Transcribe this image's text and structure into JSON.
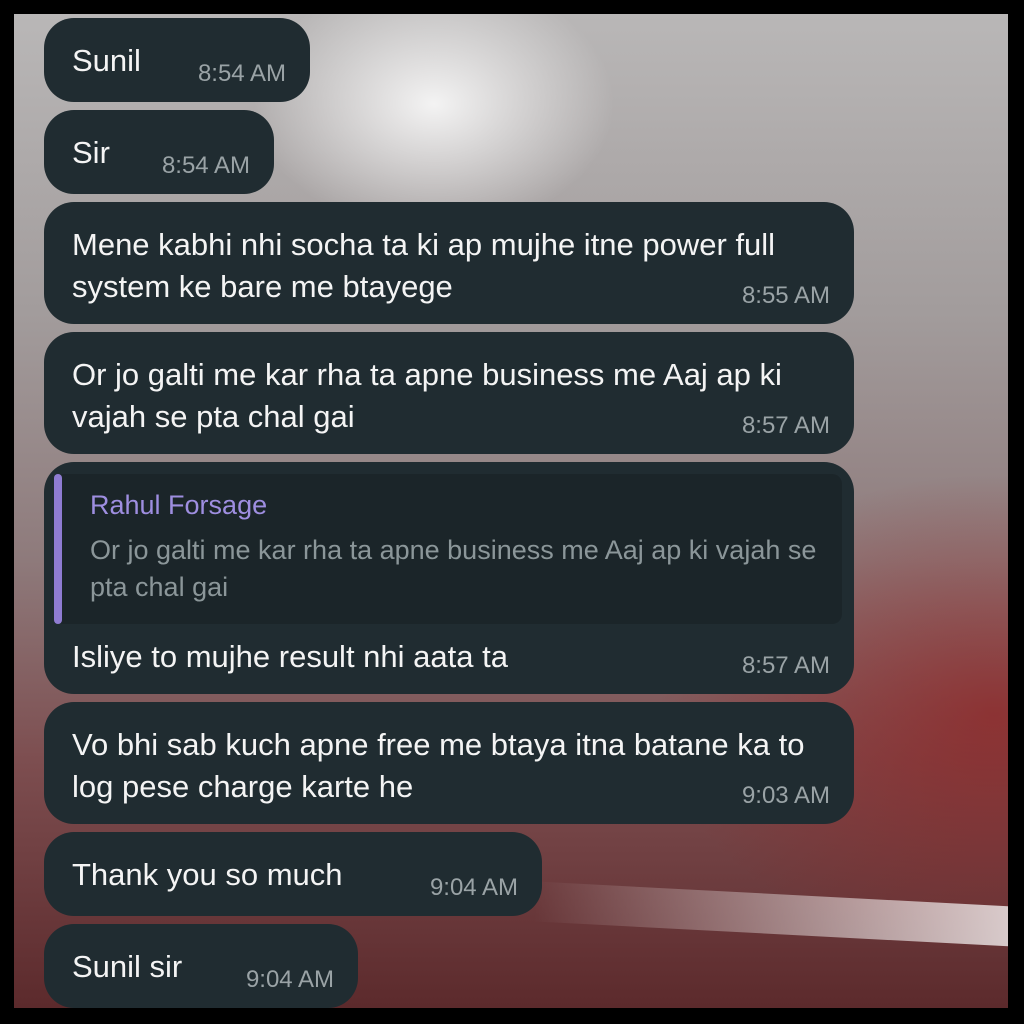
{
  "chat": {
    "messages": [
      {
        "text": "Sunil",
        "time": "8:54 AM"
      },
      {
        "text": "Sir",
        "time": "8:54 AM"
      },
      {
        "text": "Mene kabhi nhi socha ta ki ap mujhe itne power full system ke bare me btayege",
        "time": "8:55 AM"
      },
      {
        "text": "Or jo galti me kar rha ta apne business me Aaj ap ki vajah se pta chal gai",
        "time": "8:57 AM"
      },
      {
        "reply_to": {
          "author": "Rahul Forsage",
          "text": "Or jo galti me kar rha ta apne business me Aaj ap ki vajah se pta chal gai"
        },
        "text": "Isliye to mujhe result nhi  aata ta",
        "time": "8:57 AM"
      },
      {
        "text": "Vo bhi sab kuch apne free me btaya itna batane ka to log pese charge karte he",
        "time": "9:03 AM"
      },
      {
        "text": "Thank you so much",
        "time": "9:04 AM"
      },
      {
        "text": "Sunil sir",
        "time": "9:04 AM"
      }
    ]
  },
  "colors": {
    "bubble": "#202c31",
    "quote_accent": "#8f7cd2",
    "timestamp": "#9aa3a6"
  }
}
